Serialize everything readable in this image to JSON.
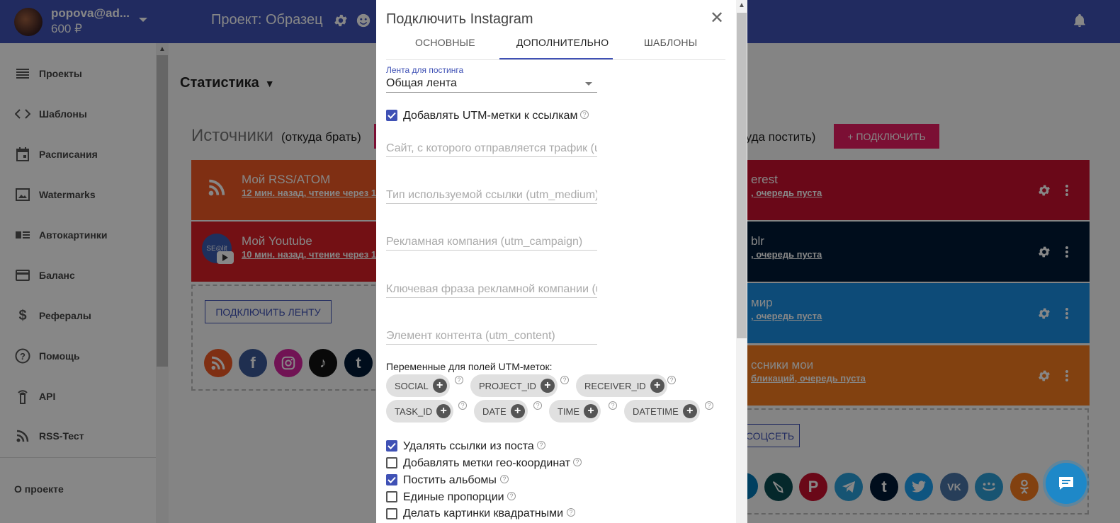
{
  "header": {
    "user_name": "popova@ad...",
    "balance": "600 ₽",
    "project_title": "Проект: Образец"
  },
  "sidebar": {
    "items": [
      {
        "label": "Проекты",
        "icon": "list-icon"
      },
      {
        "label": "Шаблоны",
        "icon": "code-icon"
      },
      {
        "label": "Расписания",
        "icon": "calendar-icon"
      },
      {
        "label": "Watermarks",
        "icon": "image-icon"
      },
      {
        "label": "Автокартинки",
        "icon": "auto-image-icon"
      },
      {
        "label": "Баланс",
        "icon": "card-icon"
      },
      {
        "label": "Рефералы",
        "icon": "dollar-icon"
      },
      {
        "label": "Помощь",
        "icon": "help-icon"
      },
      {
        "label": "API",
        "icon": "api-icon"
      },
      {
        "label": "RSS-Тест",
        "icon": "rss-icon"
      }
    ],
    "about": "О проекте"
  },
  "main": {
    "stat_title": "Статистика",
    "sources_title": "Источники",
    "sources_sub": "(откуда брать)",
    "dest_sub": "куда постить)",
    "connect_label": "+ ПОДКЛЮЧИТЬ",
    "source_cards": [
      {
        "title": "Мой RSS/ATOM",
        "sub": "12 мин. назад, чтение через 1",
        "color": "#f05a24"
      },
      {
        "title": "Мой Youtube",
        "sub": "10 мин. назад, чтение через 1",
        "color": "#d91f26"
      }
    ],
    "connect_feed_label": "ПОДКЛЮЧИТЬ ЛЕНТУ",
    "dest_cards": [
      {
        "title": "erest",
        "sub": ", очередь пуста",
        "color": "#c8102e"
      },
      {
        "title": "blr",
        "sub": ", очередь пуста",
        "color": "#001935"
      },
      {
        "title": "мир",
        "sub": ", очередь пуста",
        "color": "#1a8fe3"
      },
      {
        "title": "ссники мои",
        "sub": "бликаций, очередь пуста",
        "color": "#f57c1f"
      }
    ],
    "connect_social_label": "СОЦСЕТЬ",
    "youtube_badge": "SE◎lit"
  },
  "modal": {
    "title": "Подключить Instagram",
    "tabs": [
      "ОСНОВНЫЕ",
      "ДОПОЛНИТЕЛЬНО",
      "ШАБЛОНЫ"
    ],
    "active_tab": "ДОПОЛНИТЕЛЬНО",
    "feed_label": "Лента для постинга",
    "feed_value": "Общая лента",
    "utm_checkbox": "Добавлять UTM-метки к ссылкам",
    "fields": [
      "Сайт, с которого отправляется трафик (utm_source)",
      "Тип используемой ссылки (utm_medium)",
      "Рекламная компания (utm_campaign)",
      "Ключевая фраза рекламной компании (utm_term)",
      "Элемент контента (utm_content)"
    ],
    "vars_label": "Переменные для полей UTM-меток:",
    "chips": [
      "SOCIAL",
      "PROJECT_ID",
      "RECEIVER_ID",
      "TASK_ID",
      "DATE",
      "TIME",
      "DATETIME"
    ],
    "options": [
      {
        "label": "Удалять ссылки из поста",
        "checked": true
      },
      {
        "label": "Добавлять метки гео-координат",
        "checked": false
      },
      {
        "label": "Постить альбомы",
        "checked": true
      },
      {
        "label": "Единые пропорции",
        "checked": false
      },
      {
        "label": "Делать картинки квадратными",
        "checked": false
      }
    ]
  }
}
